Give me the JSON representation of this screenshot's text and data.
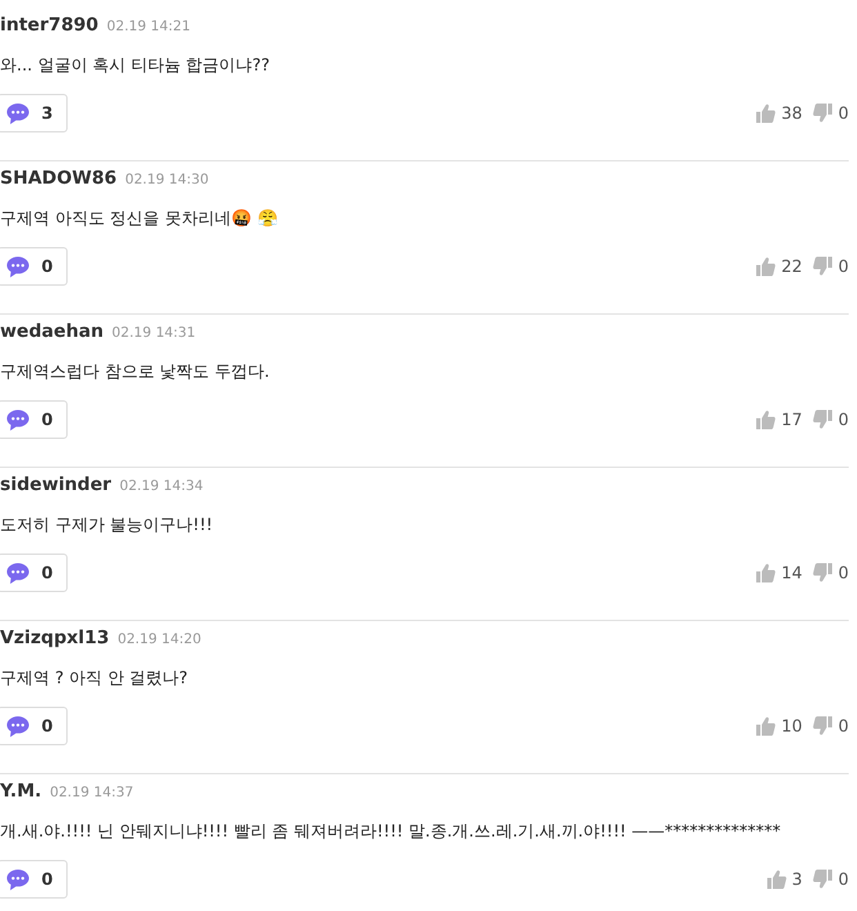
{
  "comments": [
    {
      "author": "inter7890",
      "time": "02.19 14:21",
      "text": "와... 얼굴이 혹시 티타늄 합금이냐??",
      "replies": "3",
      "likes": "38",
      "dislikes": "0"
    },
    {
      "author": "SHADOW86",
      "time": "02.19 14:30",
      "text": "구제역 아직도 정신을 못차리네🤬 😤",
      "replies": "0",
      "likes": "22",
      "dislikes": "0"
    },
    {
      "author": "wedaehan",
      "time": "02.19 14:31",
      "text": "구제역스럽다 참으로 낯짝도 두껍다.",
      "replies": "0",
      "likes": "17",
      "dislikes": "0"
    },
    {
      "author": "sidewinder",
      "time": "02.19 14:34",
      "text": "도저히 구제가 불능이구나!!!",
      "replies": "0",
      "likes": "14",
      "dislikes": "0"
    },
    {
      "author": "Vzizqpxl13",
      "time": "02.19 14:20",
      "text": "구제역 ? 아직 안 걸렸나?",
      "replies": "0",
      "likes": "10",
      "dislikes": "0"
    },
    {
      "author": "Y.M.",
      "time": "02.19 14:37",
      "text": "개.새.야.!!!! 닌 안뒈지니냐!!!! 빨리 좀 뒈져버려라!!!! 말.종.개.쓰.레.기.새.끼.야!!!! ——**************",
      "replies": "0",
      "likes": "3",
      "dislikes": "0"
    }
  ]
}
